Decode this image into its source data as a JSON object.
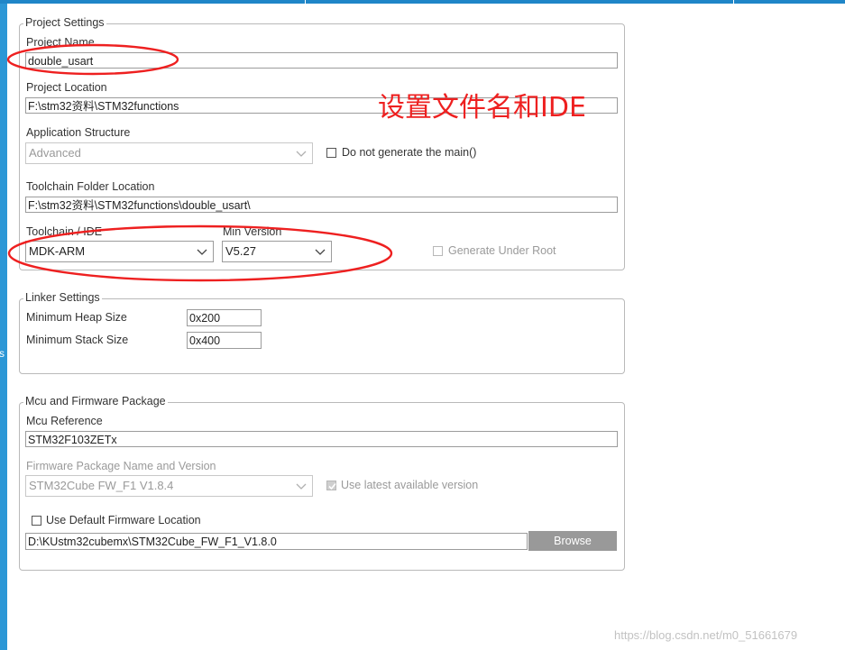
{
  "project_settings": {
    "legend": "Project Settings",
    "project_name": {
      "label": "Project Name",
      "value": "double_usart"
    },
    "project_location": {
      "label": "Project Location",
      "value": "F:\\stm32资料\\STM32functions"
    },
    "application_structure": {
      "label": "Application Structure",
      "value": "Advanced"
    },
    "do_not_generate_main": {
      "label": "Do not generate the main()",
      "checked": false
    },
    "toolchain_folder": {
      "label": "Toolchain Folder Location",
      "value": "F:\\stm32资料\\STM32functions\\double_usart\\"
    },
    "toolchain_ide": {
      "label": "Toolchain / IDE",
      "value": "MDK-ARM"
    },
    "min_version": {
      "label": "Min Version",
      "value": "V5.27"
    },
    "generate_under_root": {
      "label": "Generate Under Root",
      "checked": false
    }
  },
  "linker_settings": {
    "legend": "Linker Settings",
    "min_heap": {
      "label": "Minimum Heap Size",
      "value": "0x200"
    },
    "min_stack": {
      "label": "Minimum Stack Size",
      "value": "0x400"
    }
  },
  "mcu_firmware": {
    "legend": "Mcu and Firmware Package",
    "mcu_reference": {
      "label": "Mcu Reference",
      "value": "STM32F103ZETx"
    },
    "firmware_package": {
      "label": "Firmware Package Name and Version",
      "value": "STM32Cube FW_F1 V1.8.4"
    },
    "use_latest": {
      "label": "Use latest available version",
      "checked": true
    },
    "use_default_location": {
      "label": "Use Default Firmware Location",
      "checked": false
    },
    "firmware_path": {
      "value": "D:\\KUstm32cubemx\\STM32Cube_FW_F1_V1.8.0"
    },
    "browse_label": "Browse"
  },
  "annotation": {
    "text": "设置文件名和IDE",
    "color": "#ee2020"
  },
  "watermark": "https://blog.csdn.net/m0_51661679",
  "left_edge_glyph": "s",
  "colors": {
    "accent_blue": "#2c97d6",
    "annotation_red": "#ee2020",
    "button_gray": "#999999"
  },
  "icons": {
    "dropdown": "chevron-down-icon",
    "checkbox": "checkbox-icon",
    "checkmark": "checkmark-icon"
  }
}
